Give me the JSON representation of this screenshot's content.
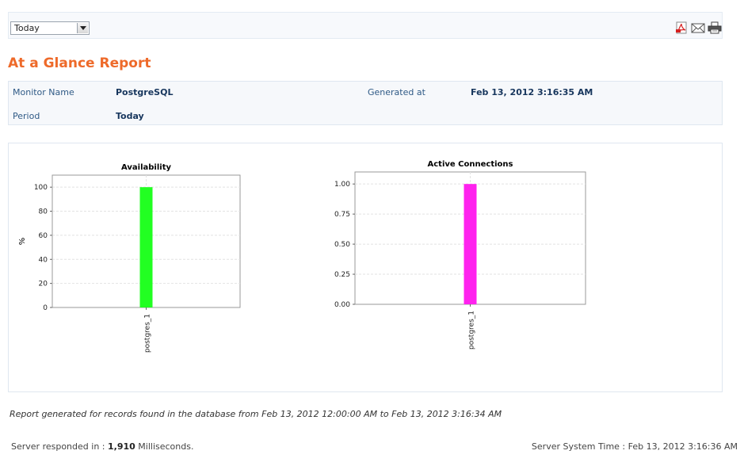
{
  "toolbar": {
    "period_selected": "Today",
    "icons": [
      "pdf-icon",
      "email-icon",
      "print-icon"
    ]
  },
  "report": {
    "title": "At a Glance Report"
  },
  "info": {
    "monitor_name_label": "Monitor Name",
    "monitor_name_value": "PostgreSQL",
    "generated_label": "Generated at",
    "generated_value": "Feb 13, 2012 3:16:35 AM",
    "period_label": "Period",
    "period_value": "Today"
  },
  "chart_data": [
    {
      "type": "bar",
      "title": "Availability",
      "ylabel": "%",
      "categories": [
        "postgres_1"
      ],
      "values": [
        100
      ],
      "ylim": [
        0,
        110
      ],
      "yticks": [
        "0",
        "20",
        "40",
        "60",
        "80",
        "100"
      ],
      "color": "#22ff22",
      "grid": true
    },
    {
      "type": "bar",
      "title": "Active Connections",
      "ylabel": "",
      "categories": [
        "postgres_1"
      ],
      "values": [
        1.0
      ],
      "ylim": [
        0,
        1.1
      ],
      "yticks": [
        "0.00",
        "0.25",
        "0.50",
        "0.75",
        "1.00"
      ],
      "color": "#ff22ee",
      "grid": true
    }
  ],
  "footer": {
    "records_note": "Report generated for records found in the database from Feb 13, 2012 12:00:00 AM to Feb 13, 2012 3:16:34 AM",
    "server_responded_prefix": "Server responded in : ",
    "server_responded_value": "1,910",
    "server_responded_suffix": " Milliseconds.",
    "server_time": "Server System Time : Feb 13, 2012 3:16:36 AM"
  }
}
